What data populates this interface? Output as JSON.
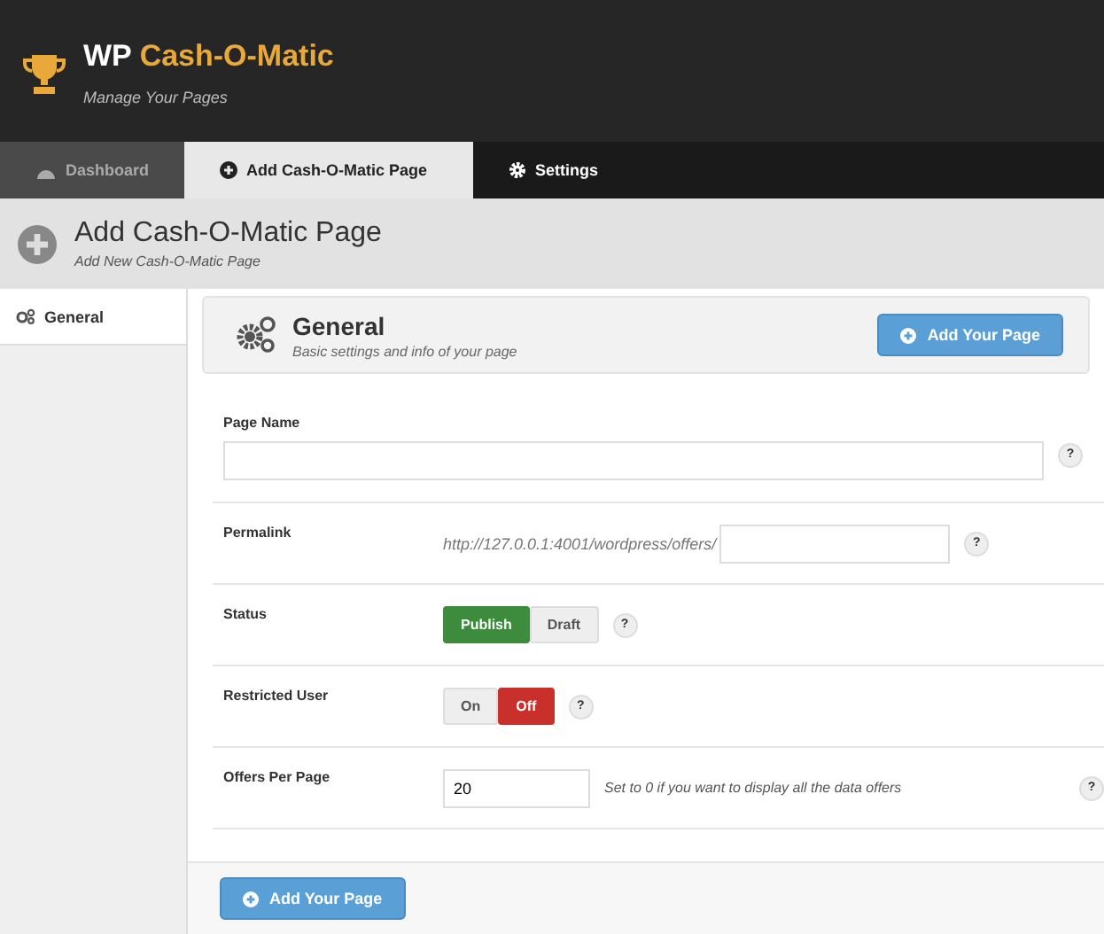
{
  "header": {
    "brand_prefix": "WP",
    "brand_name": "Cash-O-Matic",
    "tagline": "Manage Your Pages"
  },
  "tabs": [
    {
      "label": "Dashboard",
      "selected": false,
      "kind": "dashboard"
    },
    {
      "label": "Add Cash-O-Matic Page",
      "selected": true,
      "kind": "add"
    },
    {
      "label": "Settings",
      "selected": false,
      "kind": "settings"
    }
  ],
  "page_title": {
    "title": "Add Cash-O-Matic Page",
    "subtitle": "Add New Cash-O-Matic Page"
  },
  "sidebar": {
    "items": [
      {
        "label": "General",
        "selected": true
      }
    ]
  },
  "section": {
    "title": "General",
    "subtitle": "Basic settings and info of your page",
    "button": "Add Your Page"
  },
  "fields": [
    {
      "kind": "text",
      "label": "Page Name",
      "help": "?"
    },
    {
      "kind": "permalink",
      "label": "Permalink",
      "prefix": "http://127.0.0.1:4001/wordpress/offers/",
      "help": "?"
    },
    {
      "kind": "toggle",
      "label": "Status",
      "color": "#3d8b3d",
      "options": [
        {
          "label": "Publish",
          "selected": true
        },
        {
          "label": "Draft",
          "selected": false
        }
      ],
      "help": "?"
    },
    {
      "kind": "toggle",
      "label": "Restricted User",
      "color": "#c9302c",
      "options": [
        {
          "label": "On",
          "selected": false
        },
        {
          "label": "Off",
          "selected": true
        }
      ],
      "help": "?"
    },
    {
      "kind": "number",
      "label": "Offers Per Page",
      "value": "20",
      "note": "Set to 0 if you want to display all the data offers",
      "help": "?"
    }
  ],
  "footer_button": "Add Your Page"
}
